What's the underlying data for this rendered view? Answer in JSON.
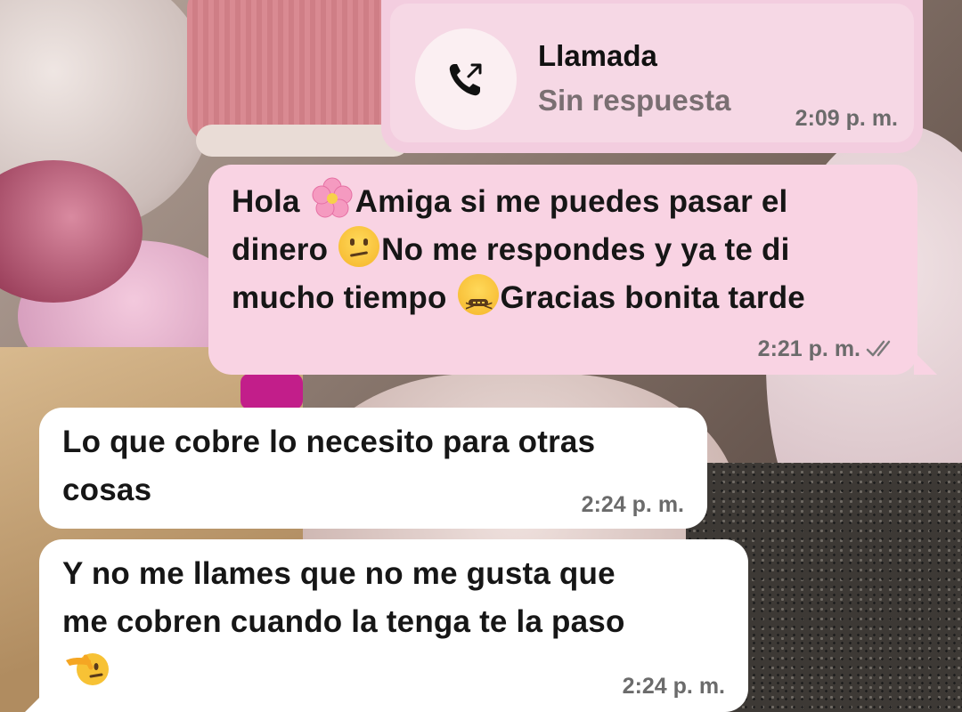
{
  "call": {
    "title": "Llamada",
    "status": "Sin respuesta",
    "time": "2:09 p. m.",
    "icon": "outgoing-call-icon"
  },
  "messages": [
    {
      "direction": "outgoing",
      "lines": [
        [
          "Hola ",
          "{flower}",
          "Amiga si me puedes pasar el"
        ],
        [
          "dinero ",
          "{confused}",
          "No me respondes y ya te di"
        ],
        [
          "mucho tiempo ",
          "{confounded}",
          "Gracias bonita tarde"
        ]
      ],
      "line1a": "Hola",
      "line1b": "Amiga si me puedes pasar el",
      "line2a": "dinero",
      "line2b": "No me respondes y ya te di",
      "line3a": "mucho tiempo",
      "line3b": "Gracias bonita tarde",
      "time": "2:21 p. m.",
      "status_icon": "double-check-icon"
    },
    {
      "direction": "incoming",
      "line1": "Lo que cobre lo necesito para otras",
      "line2": "cosas",
      "time": "2:24 p. m."
    },
    {
      "direction": "incoming",
      "line1": "Y no me llames que no me gusta que",
      "line2": "me cobren cuando la tenga te la paso",
      "emoji": "saluting-face-emoji",
      "time": "2:24 p. m."
    }
  ],
  "colors": {
    "outgoing_bubble": "#f9d3e3",
    "incoming_bubble": "#ffffff",
    "call_bubble": "#f3cddf",
    "timestamp": "#6b6b6b"
  }
}
